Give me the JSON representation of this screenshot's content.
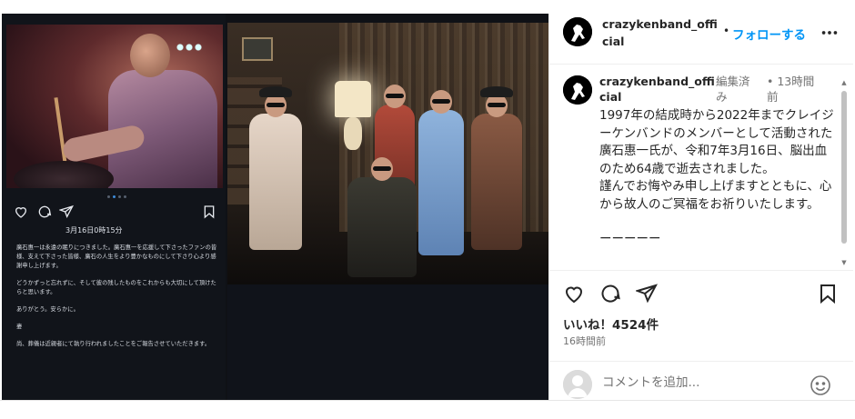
{
  "colors": {
    "accent": "#0095f6",
    "text": "#262626",
    "muted": "#737373",
    "border": "#efefef",
    "media_bg": "#0f1116"
  },
  "media": {
    "date": "3月16日0時15分",
    "caption": [
      "廣石惠一は永遠の眠りにつきました。廣石惠一を応援して下さったファンの皆様、支えて下さった皆様、廣石の人生をより豊かなものにして下さり心より感謝申し上げます。",
      "どうかずっと忘れずに、そして彼の残したものをこれからも大切にして頂けたらと思います。",
      "ありがとう。安らかに。",
      "妻",
      "尚、葬儀は近親者にて執り行われましたことをご報告させていただきます。"
    ],
    "icons": [
      "heart-icon",
      "comment-icon",
      "share-icon",
      "bookmark-icon"
    ],
    "carousel_dots": 4,
    "carousel_active": 1
  },
  "header": {
    "username": "crazykenband_official",
    "separator": "•",
    "follow_label": "フォローする",
    "more_icon": "more-horizontal-icon"
  },
  "comment": {
    "username": "crazykenband_official",
    "edited": "編集済み",
    "separator": "•",
    "time": "13時間前",
    "paragraphs": [
      "1997年の結成時から2022年までクレイジーケンバンドのメンバーとして活動された廣石惠一氏が、令和7年3月16日、脳出血のため64歳で逝去されました。",
      "謹んでお悔やみ申し上げますとともに、心から故人のご冥福をお祈りいたします。",
      "ーーーーー"
    ]
  },
  "actions": {
    "likes": "いいね！4524件",
    "ago": "16時間前",
    "icons": [
      "heart-icon",
      "comment-icon",
      "share-icon",
      "bookmark-icon"
    ]
  },
  "add_comment": {
    "placeholder": "コメントを追加...",
    "emoji_icon": "emoji-icon"
  }
}
